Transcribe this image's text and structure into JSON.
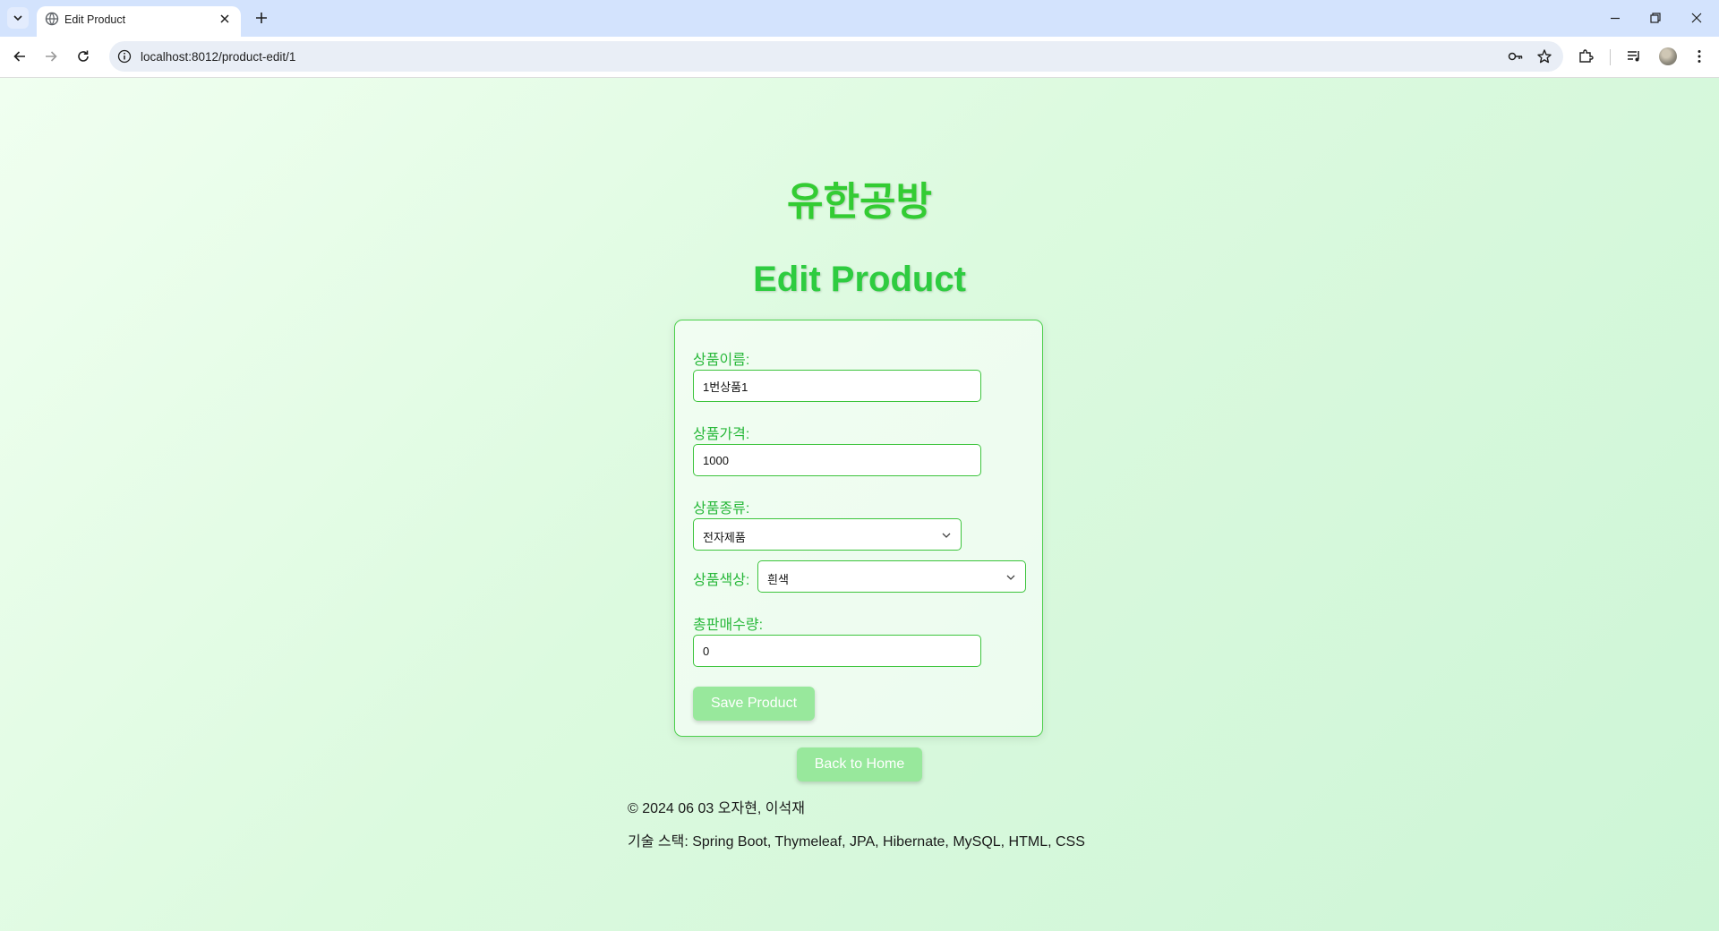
{
  "browser": {
    "tab_title": "Edit Product",
    "url": "localhost:8012/product-edit/1",
    "icons": [
      "tab-search-icon",
      "globe-icon",
      "close-icon",
      "plus-icon",
      "minimize-icon",
      "restore-icon",
      "window-close-icon",
      "back-icon",
      "forward-icon",
      "reload-icon",
      "info-icon",
      "password-key-icon",
      "bookmark-star-icon",
      "extensions-icon",
      "media-icon",
      "profile-avatar",
      "more-menu-icon"
    ]
  },
  "page": {
    "brand": "유한공방",
    "heading": "Edit Product"
  },
  "form": {
    "name_label": "상품이름:",
    "name_value": "1번상품1",
    "price_label": "상품가격:",
    "price_value": "1000",
    "category_label": "상품종류:",
    "category_value": "전자제품",
    "color_label": "상품색상:",
    "color_value": "흰색",
    "sold_label": "총판매수량:",
    "sold_value": "0",
    "save_label": "Save Product"
  },
  "back_label": "Back to Home",
  "footer": {
    "copyright": "© 2024 06 03 오자현, 이석재",
    "tech": "기술 스택: Spring Boot, Thymeleaf, JPA, Hibernate, MySQL, HTML, CSS"
  },
  "colors": {
    "accent": "#33cc33",
    "button": "#98e89c",
    "background": "#dcfadf"
  }
}
